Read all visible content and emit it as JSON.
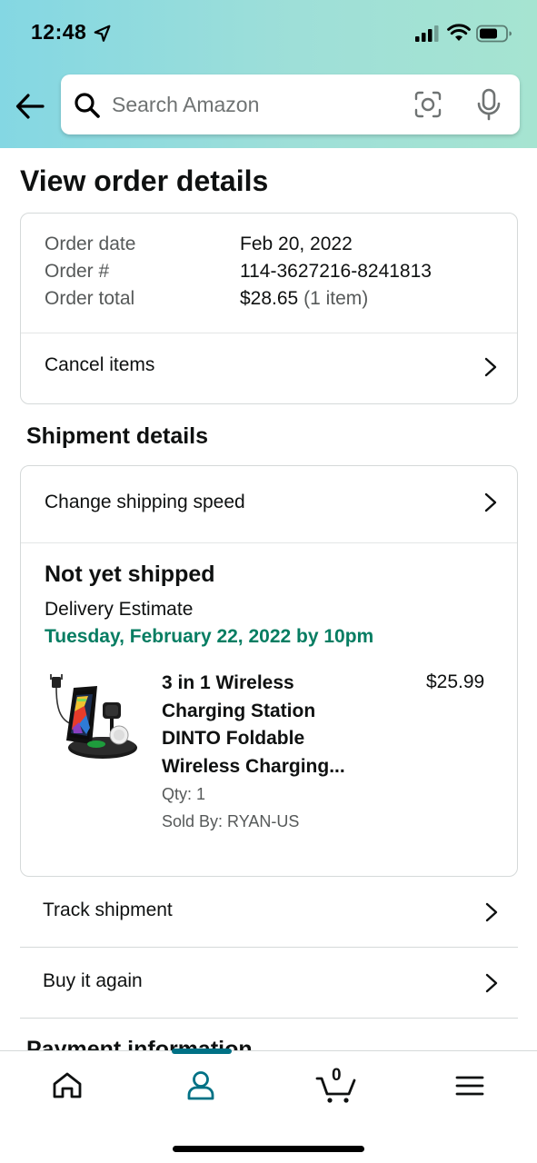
{
  "status_bar": {
    "time": "12:48"
  },
  "search": {
    "placeholder": "Search Amazon"
  },
  "page": {
    "title": "View order details"
  },
  "order_summary": {
    "rows": [
      {
        "label": "Order date",
        "value": "Feb 20, 2022"
      },
      {
        "label": "Order #",
        "value": "114-3627216-8241813"
      },
      {
        "label": "Order total",
        "value": "$28.65",
        "note": "(1 item)"
      }
    ],
    "cancel_label": "Cancel items"
  },
  "shipment": {
    "section_title": "Shipment details",
    "change_speed_label": "Change shipping speed",
    "status": "Not yet shipped",
    "delivery_label": "Delivery Estimate",
    "delivery_date": "Tuesday, February 22, 2022 by 10pm",
    "item": {
      "title_lines": [
        "3 in 1 Wireless",
        "Charging Station",
        "DINTO Foldable",
        "Wireless Charging..."
      ],
      "price": "$25.99",
      "qty": "Qty: 1",
      "seller": "Sold By: RYAN-US"
    }
  },
  "actions": {
    "track_label": "Track shipment",
    "buy_again_label": "Buy it again"
  },
  "payment": {
    "section_title": "Payment information"
  },
  "tab_bar": {
    "items": [
      {
        "name": "home",
        "icon": "home-icon"
      },
      {
        "name": "account",
        "icon": "person-icon",
        "active": true
      },
      {
        "name": "cart",
        "icon": "cart-icon"
      },
      {
        "name": "menu",
        "icon": "hamburger-menu-icon"
      }
    ],
    "cart_count": "0"
  },
  "colors": {
    "header_gradient_start": "#84d7e3",
    "header_gradient_end": "#a6e4d1",
    "delivery_green": "#067d62",
    "active_tab": "#007185",
    "text_primary": "#0f1111",
    "text_secondary": "#565959"
  }
}
